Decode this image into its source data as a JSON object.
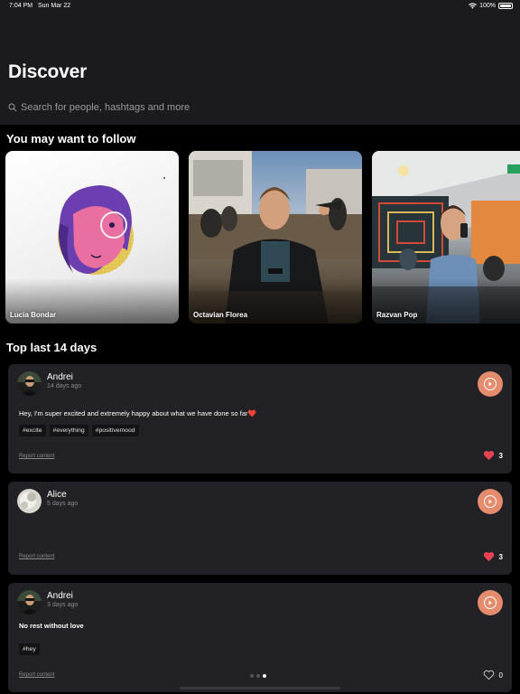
{
  "status_bar": {
    "time": "7:04 PM",
    "date": "Sun Mar 22",
    "battery": "100%",
    "battery_level": 1.0
  },
  "header": {
    "title": "Discover",
    "search_placeholder": "Search for people, hashtags and more"
  },
  "follow_section": {
    "title": "You may want to follow",
    "people": [
      {
        "name": "Lucia Bondar"
      },
      {
        "name": "Octavian Florea"
      },
      {
        "name": "Razvan Pop"
      }
    ]
  },
  "top_section": {
    "title": "Top last 14 days"
  },
  "posts": [
    {
      "author": "Andrei",
      "ago": "14 days ago",
      "text": "Hey, I'm super excited and extremely happy about what we have done so far❤️",
      "tags": [
        "#excite",
        "#everything",
        "#positivemood"
      ],
      "report": "Report content",
      "likes": "3",
      "liked": true
    },
    {
      "author": "Alice",
      "ago": "5 days ago",
      "text": "",
      "tags": [],
      "report": "Report content",
      "likes": "3",
      "liked": true
    },
    {
      "author": "Andrei",
      "ago": "3 days ago",
      "text": "No rest without love",
      "tags": [
        "#hey"
      ],
      "report": "Report content",
      "likes": "0",
      "liked": false
    }
  ],
  "pagination": {
    "pages": 3,
    "active_index": 2
  },
  "colors": {
    "accent": "#e58b6e",
    "heart": "#e8434f",
    "card_bg": "#222226",
    "header_bg": "#1b1b1e"
  }
}
